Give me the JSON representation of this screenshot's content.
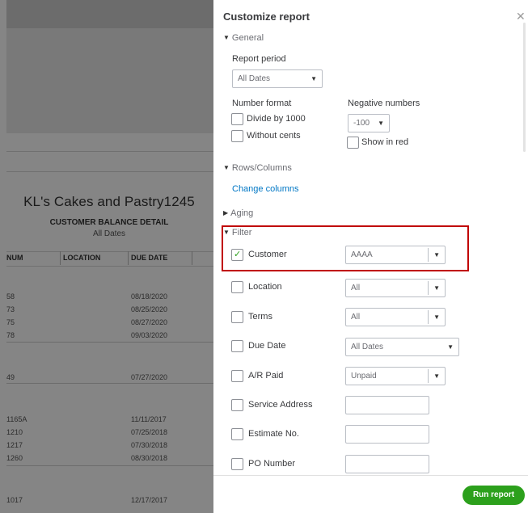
{
  "report": {
    "company": "KL's Cakes and Pastry1245",
    "title": "CUSTOMER BALANCE DETAIL",
    "subtitle": "All Dates",
    "columns": [
      "NUM",
      "LOCATION",
      "DUE DATE"
    ],
    "rows": [
      {
        "num": "58",
        "due": "08/18/2020"
      },
      {
        "num": "73",
        "due": "08/25/2020"
      },
      {
        "num": "75",
        "due": "08/27/2020"
      },
      {
        "num": "78",
        "due": "09/03/2020"
      },
      {
        "num": "49",
        "due": "07/27/2020"
      },
      {
        "num": "1165A",
        "due": "11/11/2017"
      },
      {
        "num": "1210",
        "due": "07/25/2018"
      },
      {
        "num": "1217",
        "due": "07/30/2018"
      },
      {
        "num": "1260",
        "due": "08/30/2018"
      },
      {
        "num": "1017",
        "due": "12/17/2017"
      }
    ]
  },
  "panel": {
    "title": "Customize report",
    "close_icon": "close-icon",
    "general": {
      "label": "General",
      "report_period_label": "Report period",
      "report_period_value": "All Dates",
      "number_format_label": "Number format",
      "divide_label": "Divide by 1000",
      "without_cents_label": "Without cents",
      "negative_numbers_label": "Negative numbers",
      "negative_value": "-100",
      "show_in_red_label": "Show in red"
    },
    "rows_columns": {
      "label": "Rows/Columns",
      "change_columns": "Change columns"
    },
    "aging": {
      "label": "Aging"
    },
    "filter": {
      "label": "Filter",
      "customer": {
        "label": "Customer",
        "value": "AAAA",
        "checked": true
      },
      "location": {
        "label": "Location",
        "value": "All"
      },
      "terms": {
        "label": "Terms",
        "value": "All"
      },
      "due_date": {
        "label": "Due Date",
        "value": "All Dates"
      },
      "ar_paid": {
        "label": "A/R Paid",
        "value": "Unpaid"
      },
      "service_address": {
        "label": "Service Address",
        "value": ""
      },
      "estimate_no": {
        "label": "Estimate No.",
        "value": ""
      },
      "po_number": {
        "label": "PO Number",
        "value": ""
      }
    },
    "run_report": "Run report"
  },
  "colors": {
    "accent_green": "#2ca01c",
    "link_blue": "#0077c5",
    "highlight_red": "#c00000"
  }
}
